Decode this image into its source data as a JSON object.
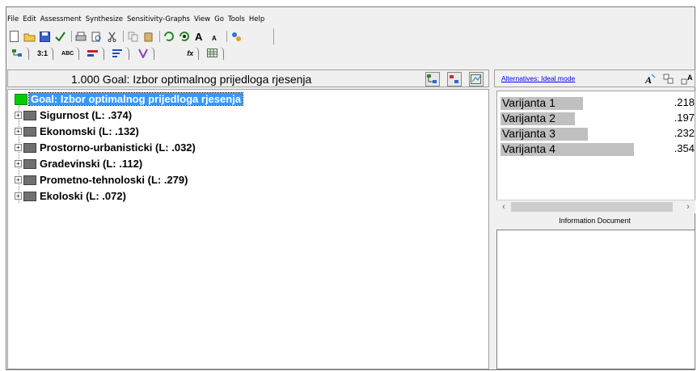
{
  "menu": [
    {
      "label": "File"
    },
    {
      "label": "Edit"
    },
    {
      "label": "Assessment"
    },
    {
      "label": "Synthesize"
    },
    {
      "label": "Sensitivity-Graphs"
    },
    {
      "label": "View"
    },
    {
      "label": "Go"
    },
    {
      "label": "Tools"
    },
    {
      "label": "Help"
    }
  ],
  "toolbar": {
    "buttons": [
      "new-file-icon",
      "open-folder-icon",
      "save-icon",
      "checkmark-icon",
      "print-icon",
      "print-preview-icon",
      "cut-icon",
      "copy-icon",
      "paste-icon",
      "refresh-icon",
      "refresh-green-icon",
      "font-large-icon",
      "font-small-icon",
      "help-icon"
    ]
  },
  "toolbar2": {
    "tabs": [
      "",
      "3:1",
      "ABC",
      "",
      "",
      "",
      "fx",
      ""
    ]
  },
  "left_header": {
    "title": "1.000  Goal: Izbor optimalnog prijedloga rjesenja"
  },
  "tree": {
    "goal": "Goal: Izbor optimalnog prijedloga rjesenja",
    "nodes": [
      {
        "label": "Sigurnost (L: .374)"
      },
      {
        "label": "Ekonomski (L: .132)"
      },
      {
        "label": "Prostorno-urbanisticki (L: .032)"
      },
      {
        "label": "Gradevinski (L: .112)"
      },
      {
        "label": "Prometno-tehnoloski (L: .279)"
      },
      {
        "label": "Ekoloski (L: .072)"
      }
    ]
  },
  "right_header": {
    "link": "Alternatives: Ideal mode"
  },
  "alternatives": [
    {
      "name": "Varijanta 1",
      "value": ".218",
      "weight": 0.218
    },
    {
      "name": "Varijanta 2",
      "value": ".197",
      "weight": 0.197
    },
    {
      "name": "Varijanta 3",
      "value": ".232",
      "weight": 0.232
    },
    {
      "name": "Varijanta 4",
      "value": ".354",
      "weight": 0.354
    }
  ],
  "info_document": {
    "title": "Information Document"
  },
  "colors": {
    "goal_green": "#00cc00",
    "selection_blue": "#3399ff",
    "node_gray": "#707070",
    "bar_gray": "#c0c0c0"
  }
}
